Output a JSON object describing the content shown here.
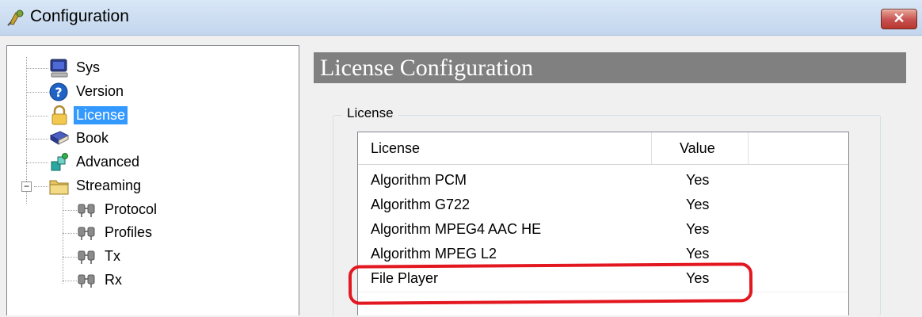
{
  "window": {
    "title": "Configuration",
    "close_symbol": "✕"
  },
  "tree": {
    "items": [
      {
        "label": "Sys",
        "icon": "monitor-icon"
      },
      {
        "label": "Version",
        "icon": "help-icon"
      },
      {
        "label": "License",
        "icon": "lock-icon",
        "selected": true
      },
      {
        "label": "Book",
        "icon": "book-icon"
      },
      {
        "label": "Advanced",
        "icon": "advanced-icon"
      },
      {
        "label": "Streaming",
        "icon": "folder-icon",
        "expanded": true,
        "expander": "−"
      },
      {
        "label": "Protocol",
        "icon": "network-icon"
      },
      {
        "label": "Profiles",
        "icon": "network-icon"
      },
      {
        "label": "Tx",
        "icon": "network-icon"
      },
      {
        "label": "Rx",
        "icon": "network-icon"
      }
    ]
  },
  "panel": {
    "title": "License Configuration"
  },
  "group": {
    "label": "License"
  },
  "table": {
    "columns": [
      "License",
      "Value"
    ],
    "rows": [
      {
        "license": "Algorithm PCM",
        "value": "Yes"
      },
      {
        "license": "Algorithm G722",
        "value": "Yes"
      },
      {
        "license": "Algorithm MPEG4 AAC HE",
        "value": "Yes"
      },
      {
        "license": "Algorithm MPEG L2",
        "value": "Yes"
      },
      {
        "license": "File Player",
        "value": "Yes",
        "annotated": true
      }
    ]
  },
  "colors": {
    "selection": "#3399ff",
    "annotation": "#e3171f",
    "panel_header": "#808080"
  }
}
